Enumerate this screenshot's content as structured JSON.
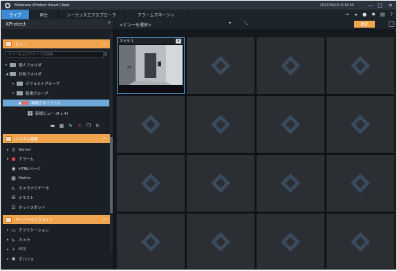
{
  "titlebar": {
    "app_title": "Milestone XProtect Smart Client",
    "datetime": "2017/06/05 9:18:55",
    "minimize_glyph": "—",
    "maximize_glyph": "□",
    "close_glyph": "✕"
  },
  "tabs": [
    {
      "label": "ライブ",
      "active": true
    },
    {
      "label": "再生",
      "active": false
    },
    {
      "label": "シーケンスエクスプローラ",
      "active": false
    },
    {
      "label": "アラームマネージャ",
      "active": false
    }
  ],
  "toolbar_icons": [
    "share-icon",
    "arrow-icon",
    "info-icon",
    "settings-icon",
    "status-icon",
    "help-icon"
  ],
  "left_panel": {
    "title": "XProtect",
    "collapse_glyph": "‹",
    "views_section": {
      "title": "ビュー",
      "search_placeholder": "ビューおよびグループを検索...",
      "tree": [
        {
          "label": "個人フォルダ",
          "level": 0,
          "icon": "folder-icon"
        },
        {
          "label": "共有フォルダ",
          "level": 0,
          "icon": "folder-icon"
        },
        {
          "label": "デフォルトグループ",
          "level": 1,
          "icon": "folder-icon"
        },
        {
          "label": "新規グループ",
          "level": 1,
          "icon": "folder-icon"
        },
        {
          "label": "新規グループ (2)",
          "level": 2,
          "icon": "folder-icon",
          "selected": true
        },
        {
          "label": "新規ビュー (4 x 4)",
          "level": 3,
          "icon": "grid-view-icon"
        }
      ],
      "tools": [
        "new-group-icon",
        "new-view-icon",
        "edit-icon",
        "delete-icon",
        "copy-icon",
        "refresh-icon"
      ]
    },
    "system_overview": {
      "title": "システム概要",
      "items": [
        {
          "label": "Server",
          "icon": "server-icon"
        },
        {
          "label": "アラーム",
          "icon": "alarm-icon"
        },
        {
          "label": "HTMLページ",
          "icon": "html-icon"
        },
        {
          "label": "Matrix",
          "icon": "matrix-icon"
        },
        {
          "label": "カメラナビゲータ",
          "icon": "camera-navigator-icon"
        },
        {
          "label": "テキスト",
          "icon": "text-icon"
        },
        {
          "label": "ホットスポット",
          "icon": "hotspot-icon"
        }
      ]
    },
    "server_tasks": {
      "title": "サーバータスクメイト",
      "items": [
        {
          "label": "アプリケーション",
          "icon": "application-icon"
        },
        {
          "label": "カメラ",
          "icon": "camera-icon"
        },
        {
          "label": "PTZ",
          "icon": "ptz-icon"
        },
        {
          "label": "デバイス",
          "icon": "device-icon"
        }
      ]
    }
  },
  "view_bar": {
    "select_label": "<ビューを選択>",
    "setup_label": "設定"
  },
  "camera": {
    "name": "カメラ 1",
    "close_glyph": "✕"
  },
  "grid": {
    "rows": 4,
    "cols": 4,
    "active_cell": 0
  },
  "colors": {
    "accent_blue": "#3d8bd4",
    "section_orange": "#f0a44e",
    "selected_item": "#6fa7d6",
    "empty_cell": "#2b2e33"
  }
}
